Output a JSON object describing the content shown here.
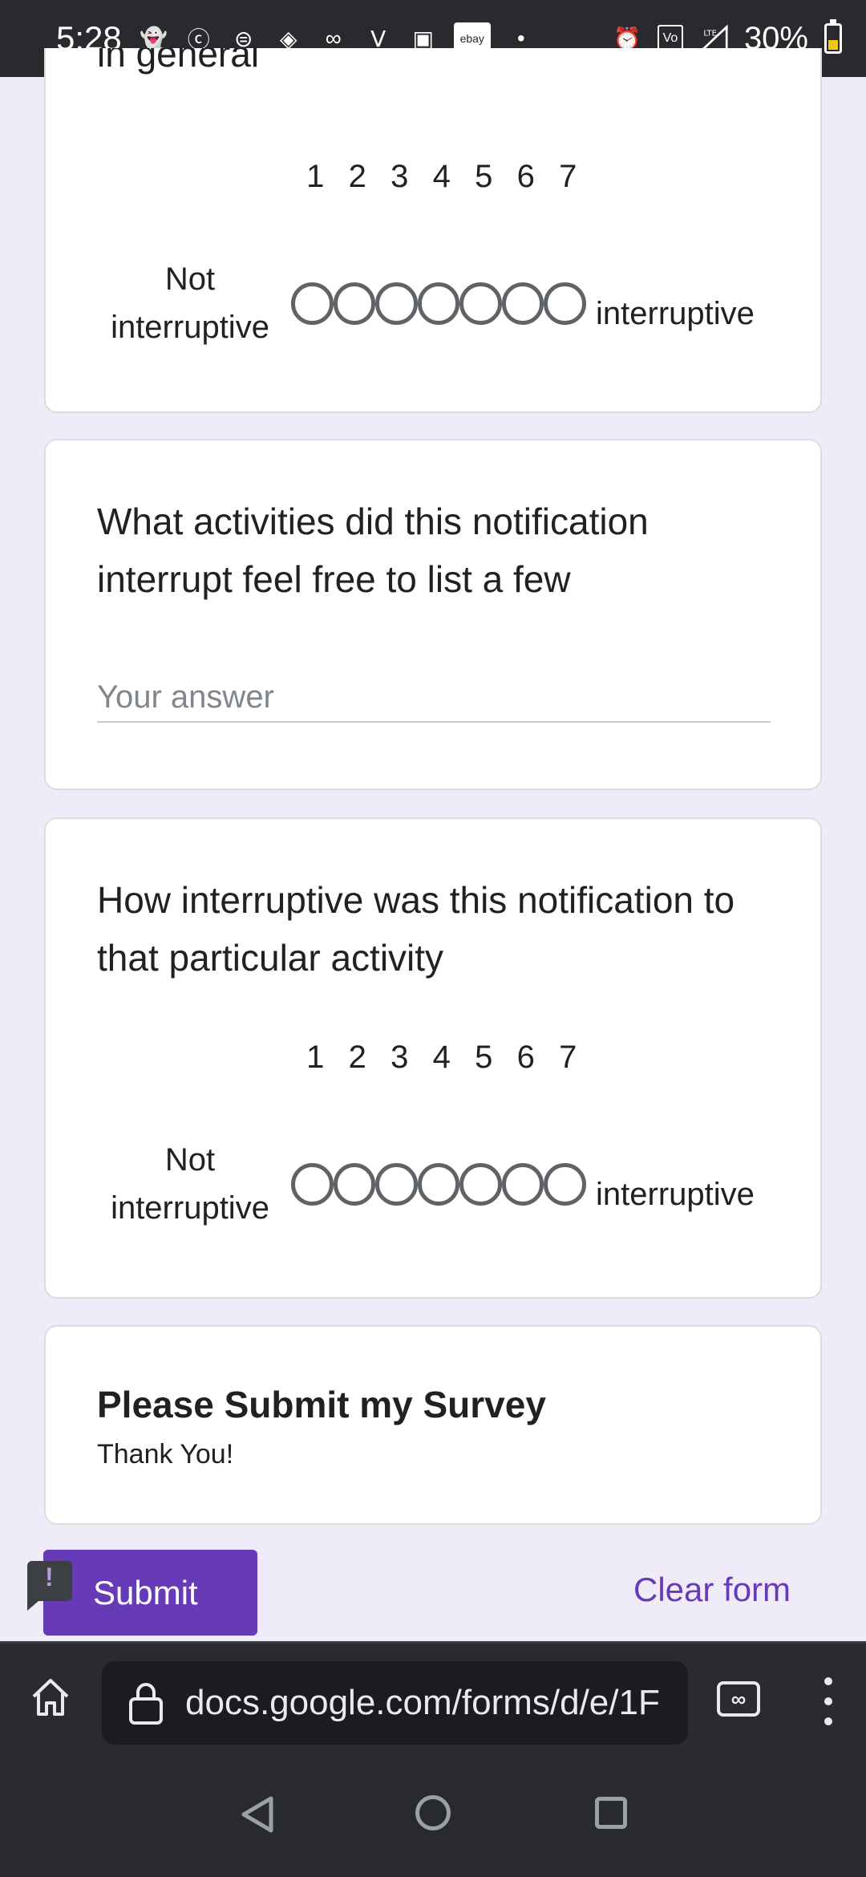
{
  "status_bar": {
    "time": "5:28",
    "ebay_label": "ebay",
    "network_label": "LTE",
    "battery": "30%"
  },
  "card1": {
    "partial_title": "in general",
    "scale_numbers": [
      "1",
      "2",
      "3",
      "4",
      "5",
      "6",
      "7"
    ],
    "left_label_line1": "Not",
    "left_label_line2": "interruptive",
    "right_label": "interruptive"
  },
  "card2": {
    "question": "What activities did this notification interrupt feel free to list a few",
    "placeholder": "Your answer"
  },
  "card3": {
    "question": "How interruptive was this notification to that particular activity",
    "scale_numbers": [
      "1",
      "2",
      "3",
      "4",
      "5",
      "6",
      "7"
    ],
    "left_label_line1": "Not",
    "left_label_line2": "interruptive",
    "right_label": "interruptive"
  },
  "card4": {
    "title": "Please Submit my Survey",
    "description": "Thank You!"
  },
  "actions": {
    "submit_label": "Submit",
    "clear_label": "Clear form"
  },
  "browser": {
    "url": "docs.google.com/forms/d/e/1F"
  },
  "colors": {
    "accent": "#673ab7",
    "page_background": "#efebf8",
    "status_bar": "#292a2e"
  }
}
